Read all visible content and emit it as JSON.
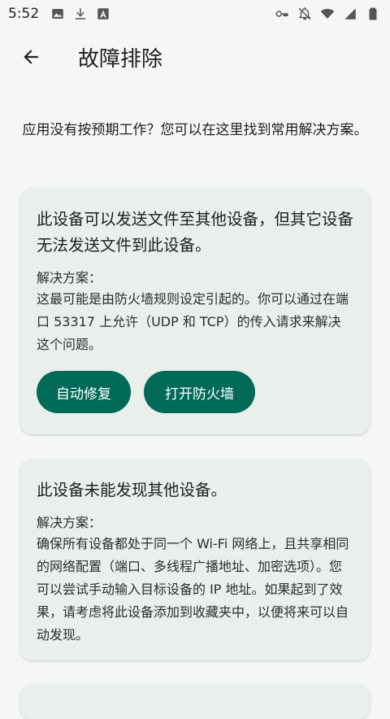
{
  "status_bar": {
    "time": "5:52",
    "left_icons": [
      "image-icon",
      "download-icon",
      "translate-icon"
    ],
    "right_icons": [
      "key-icon",
      "notifications-off-icon",
      "wifi-icon",
      "signal-icon",
      "battery-icon"
    ]
  },
  "app_bar": {
    "back_icon": "arrow-left-icon",
    "title": "故障排除"
  },
  "intro": "应用没有按预期工作？您可以在这里找到常用解决方案。",
  "cards": [
    {
      "title": "此设备可以发送文件至其他设备，但其它设备无法发送文件到此设备。",
      "solution_label": "解决方案：",
      "solution_text": "这最可能是由防火墙规则设定引起的。你可以通过在端口 53317 上允许（UDP 和 TCP）的传入请求来解决这个问题。",
      "buttons": [
        "自动修复",
        "打开防火墙"
      ]
    },
    {
      "title": "此设备未能发现其他设备。",
      "solution_label": "解决方案：",
      "solution_text": "确保所有设备都处于同一个 Wi-Fi 网络上，且共享相同的网络配置（端口、多线程广播地址、加密选项）。您可以尝试手动输入目标设备的 IP 地址。如果起到了效果，请考虑将此设备添加到收藏夹中，以便将来可以自动发现。"
    }
  ],
  "colors": {
    "background": "#f4f7f5",
    "card": "#e9efec",
    "accent": "#006a58",
    "button_text": "#ffffff"
  }
}
